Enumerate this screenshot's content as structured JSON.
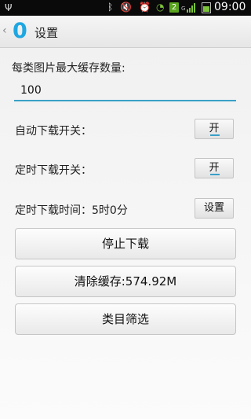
{
  "status_bar": {
    "time": "09:00",
    "notification_count": "2",
    "network": "G"
  },
  "header": {
    "title": "设置"
  },
  "cache": {
    "label": "每类图片最大缓存数量:",
    "value": "100"
  },
  "auto_download": {
    "label": "自动下载开关：",
    "button": "开"
  },
  "timed_download": {
    "label": "定时下载开关：",
    "button": "开"
  },
  "download_time": {
    "label": "定时下载时间：5时0分",
    "button": "设置"
  },
  "actions": {
    "stop_download": "停止下载",
    "clear_cache": "清除缓存:574.92M",
    "category_filter": "类目筛选"
  }
}
